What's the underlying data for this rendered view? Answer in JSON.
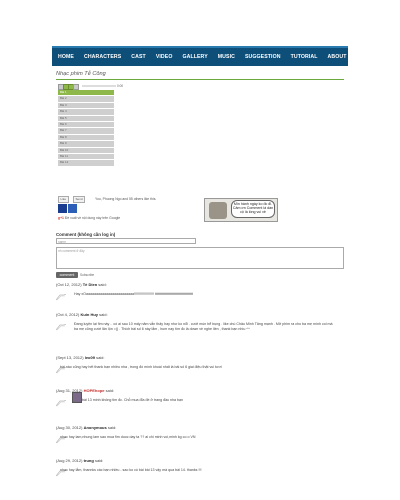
{
  "nav": {
    "items": [
      "HOME",
      "CHARACTERS",
      "CAST",
      "VIDEO",
      "GALLERY",
      "MUSIC",
      "SUGGESTION",
      "TUTORIAL",
      "ABOUT"
    ]
  },
  "page_title": "Nhạc phim Tễ Công",
  "player": {
    "time": "0:00",
    "playlist": [
      "Bài 1",
      "Bài 2",
      "Bài 3",
      "Bài 4",
      "Bài 5",
      "Bài 6",
      "Bài 7",
      "Bài 8",
      "Bài 9",
      "Bài 10",
      "Bài 11",
      "Bài 12"
    ],
    "accent_color": "#8fb84a"
  },
  "share": {
    "like_label": "Like",
    "send_label": "Send",
    "fb_text": "You, Phuong Ngo and 55 others like this.",
    "gplus_text": "Đề xuất về nội dung này trên Google"
  },
  "cartoon": {
    "bubble_text": "Mìn hành ngày ko đc đi. Cảm ơn Comment lá dàn cộ là lòng vui vẻ"
  },
  "comment_form": {
    "title": "Comment (không cần log in)",
    "name_placeholder": "name",
    "comment_placeholder": "nh comment ở đây",
    "submit_label": "comment",
    "subscribe_text": "Subscribe"
  },
  "comments": [
    {
      "date": "(Oct 12, 2012)",
      "author": "Tè Dien",
      "said": "said:",
      "body": "Hay xOaaaaaaaaaaaaaaaaaaaaaaaa!!!!!!!!!!!!!!!!!!!! tttttttttttttttttttttttttttttttttttttt"
    },
    {
      "date": "(Oct 4, 2012)",
      "author": "Kuin Huy",
      "said": "said:",
      "body": "Đang luyện lại fim này .. có ai sau 10 mấy năm vẫn thấy hay như ko nổi . cười mún bể bụng . like chú Châu Minh Tăng mạnh . Mở phim ra cho ba mẹ mình coi mà ba mẹ cũng cười lăn lộn =)) . Thích bài số 6 này lắm , hum nay tìm đc là down về nghe liền , thank bạn nhìu ^^"
    },
    {
      "date": "(Sept 13, 2012)",
      "author": "leo09",
      "said": "said:",
      "body": "bài nào cũng hay hết thank bạn nhiều nha , trong đó mình khoái nhất là bài số 6 giai điệu thật vui tươi"
    },
    {
      "date": "(Aug 31, 2012)",
      "author": "HOPEhope",
      "said": "said:",
      "body": "bài 13 minh không tim đc. Chỗ mua đĩa đề ở trang đầu nha bạn"
    },
    {
      "date": "(Aug 30, 2012)",
      "author": "Anonymous",
      "said": "said:",
      "body": "nhac hay lam,nhung lam sao mua fim duoc day ta ?? ai chi minh voi,minh kg co o VN"
    },
    {
      "date": "(Aug 29, 2012)",
      "author": "trung",
      "said": "said:",
      "body": "nhạc hay lắm, thannks các bạn nhiều - sao ko có bài bài 13 vậy mà qua bài 14. thanks !!!"
    }
  ]
}
